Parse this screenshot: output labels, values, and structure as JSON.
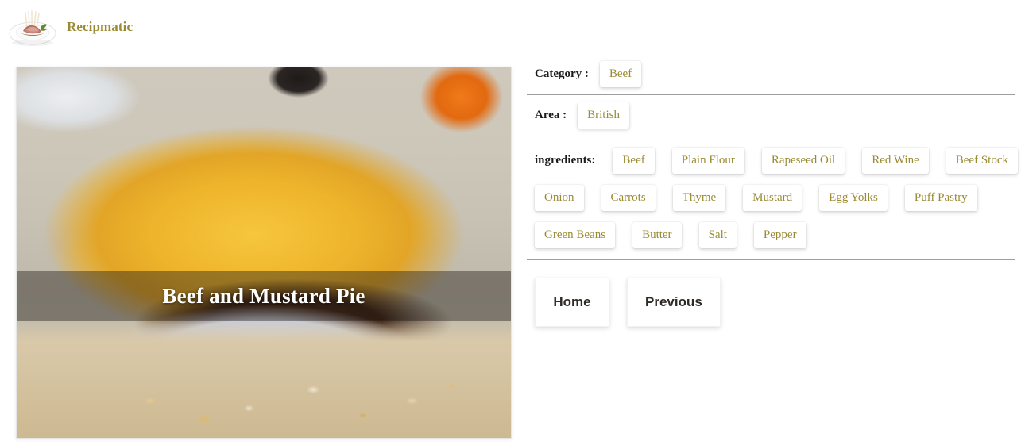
{
  "header": {
    "brand": "Recipmatic",
    "logo_icon": "lamb-rack-plate-logo"
  },
  "recipe": {
    "title": "Beef and Mustard Pie",
    "image_alt": "beef-and-mustard-pie-photo"
  },
  "meta": {
    "category_label": "Category :",
    "category_value": "Beef",
    "area_label": "Area :",
    "area_value": "British"
  },
  "ingredients": {
    "label": "ingredients:",
    "rows": [
      [
        "Beef",
        "Plain Flour",
        "Rapeseed Oil",
        "Red Wine",
        "Beef Stock"
      ],
      [
        "Onion",
        "Carrots",
        "Thyme",
        "Mustard",
        "Egg Yolks",
        "Puff Pastry"
      ],
      [
        "Green Beans",
        "Butter",
        "Salt",
        "Pepper"
      ]
    ]
  },
  "actions": {
    "home": "Home",
    "previous": "Previous"
  },
  "colors": {
    "accent": "#9a8b33",
    "text": "#1b1b1b",
    "divider": "#9e9e9e",
    "card": "#ffffff"
  }
}
